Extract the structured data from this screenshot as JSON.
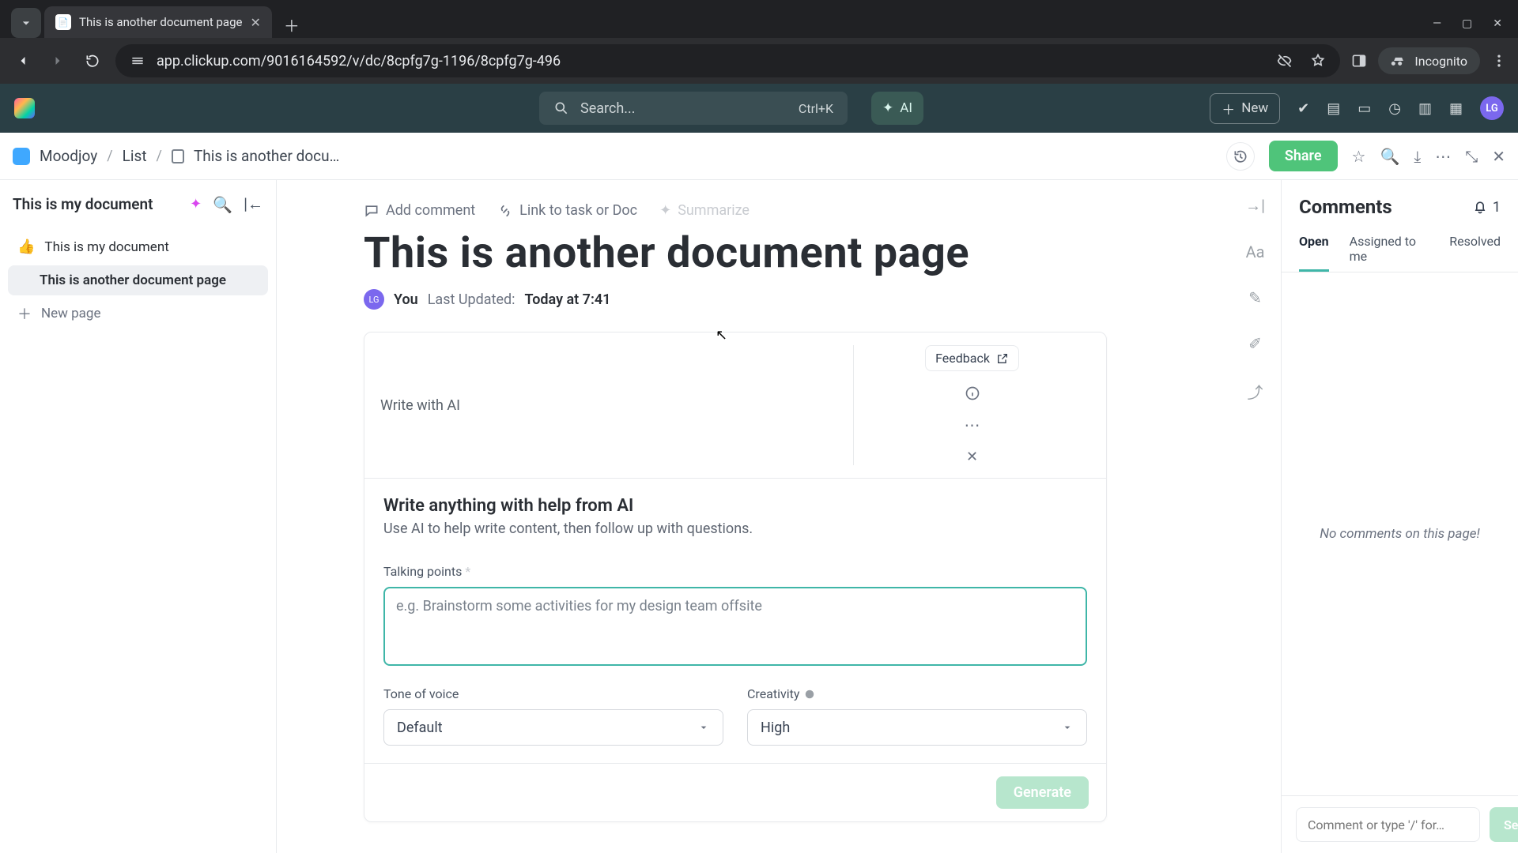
{
  "browser": {
    "tab_title": "This is another document page",
    "url": "app.clickup.com/9016164592/v/dc/8cpfg7g-1196/8cpfg7g-496",
    "incognito_label": "Incognito"
  },
  "app_top": {
    "search_placeholder": "Search...",
    "search_shortcut": "Ctrl+K",
    "ai_label": "AI",
    "new_label": "New",
    "avatar_initials": "LG"
  },
  "breadcrumbs": {
    "workspace": "Moodjoy",
    "list": "List",
    "doc": "This is another docu…"
  },
  "toolbar": {
    "share": "Share"
  },
  "left": {
    "title": "This is my document",
    "items": [
      {
        "emoji": "👍",
        "label": "This is my document"
      },
      {
        "label": "This is another document page",
        "active": true
      }
    ],
    "new_page": "New page"
  },
  "doc": {
    "actions": {
      "add_comment": "Add comment",
      "link": "Link to task or Doc",
      "summarize": "Summarize"
    },
    "title": "This is another document page",
    "byline": {
      "avatar": "LG",
      "you": "You",
      "last_updated_label": "Last Updated:",
      "when": "Today at 7:41"
    }
  },
  "ai": {
    "header": "Write with AI",
    "feedback": "Feedback",
    "title": "Write anything with help from AI",
    "subtitle": "Use AI to help write content, then follow up with questions.",
    "talking_points_label": "Talking points",
    "required_mark": "*",
    "placeholder": "e.g. Brainstorm some activities for my design team offsite",
    "tone_label": "Tone of voice",
    "tone_value": "Default",
    "creativity_label": "Creativity",
    "creativity_value": "High",
    "generate": "Generate"
  },
  "comments": {
    "title": "Comments",
    "badge_count": "1",
    "tabs": {
      "open": "Open",
      "assigned": "Assigned to me",
      "resolved": "Resolved"
    },
    "empty": "No comments on this page!",
    "compose_placeholder": "Comment or type '/' for…",
    "send": "Send"
  }
}
